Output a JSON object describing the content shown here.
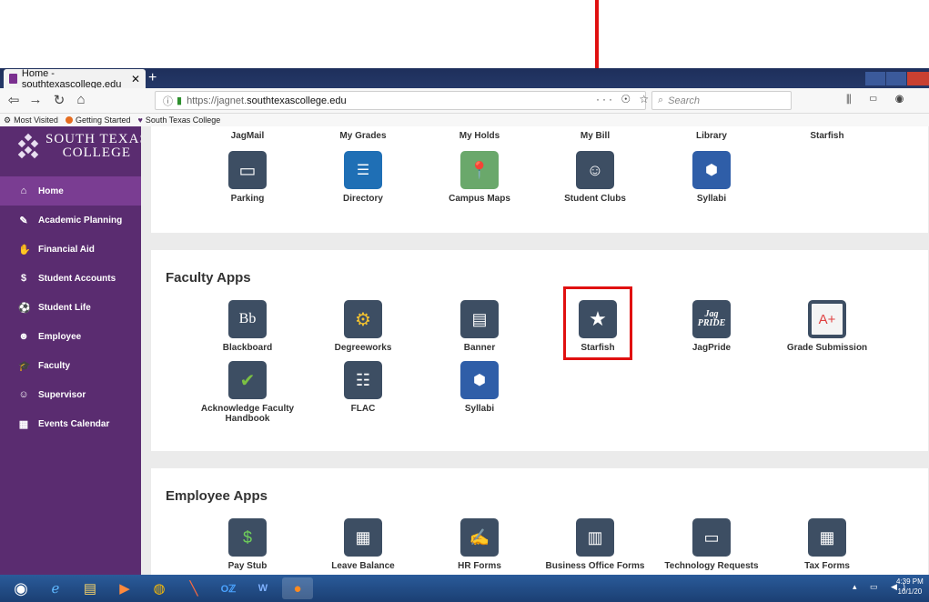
{
  "browser": {
    "tab_title": "Home - southtexascollege.edu",
    "tab_close": "✕",
    "new_tab": "+",
    "url_prefix": "https://jagnet.",
    "url_host": "southtexascollege.edu",
    "url_extra": "··· ☉ ☆",
    "search_placeholder": "Search",
    "bookmarks": [
      "Most Visited",
      "Getting Started",
      "South Texas College"
    ]
  },
  "sidebar": {
    "logo_line1": "SOUTH TEXAS",
    "logo_line2": "COLLEGE",
    "items": [
      {
        "label": "Home",
        "icon": "home-icon",
        "glyph": "⌂"
      },
      {
        "label": "Academic Planning",
        "icon": "pencil-icon",
        "glyph": "✎"
      },
      {
        "label": "Financial Aid",
        "icon": "handshake-icon",
        "glyph": "✋"
      },
      {
        "label": "Student Accounts",
        "icon": "dollar-icon",
        "glyph": "$"
      },
      {
        "label": "Student Life",
        "icon": "soccer-icon",
        "glyph": "⚽"
      },
      {
        "label": "Employee",
        "icon": "user-icon",
        "glyph": "☻"
      },
      {
        "label": "Faculty",
        "icon": "graduation-cap-icon",
        "glyph": "🎓"
      },
      {
        "label": "Supervisor",
        "icon": "users-icon",
        "glyph": "☺"
      },
      {
        "label": "Events Calendar",
        "icon": "calendar-icon",
        "glyph": "▦"
      }
    ]
  },
  "student_apps": {
    "row1": [
      "JagMail",
      "My Grades",
      "My Holds",
      "My Bill",
      "Library",
      "Starfish"
    ],
    "row2": [
      "Parking",
      "Directory",
      "Campus Maps",
      "Student Clubs",
      "Syllabi"
    ]
  },
  "faculty_apps": {
    "title": "Faculty Apps",
    "items": [
      "Blackboard",
      "Degreeworks",
      "Banner",
      "Starfish",
      "JagPride",
      "Grade Submission",
      "Acknowledge Faculty Handbook",
      "FLAC",
      "Syllabi"
    ]
  },
  "employee_apps": {
    "title": "Employee Apps",
    "items": [
      "Pay Stub",
      "Leave Balance",
      "HR Forms",
      "Business Office Forms",
      "Technology Requests",
      "Tax Forms"
    ]
  },
  "taskbar": {
    "clock_time": "4:39 PM",
    "clock_date": "10/1/20"
  },
  "colors": {
    "sidebar": "#5a2c70",
    "sidebar_active": "#7a3d92",
    "annotation": "#e01010"
  }
}
